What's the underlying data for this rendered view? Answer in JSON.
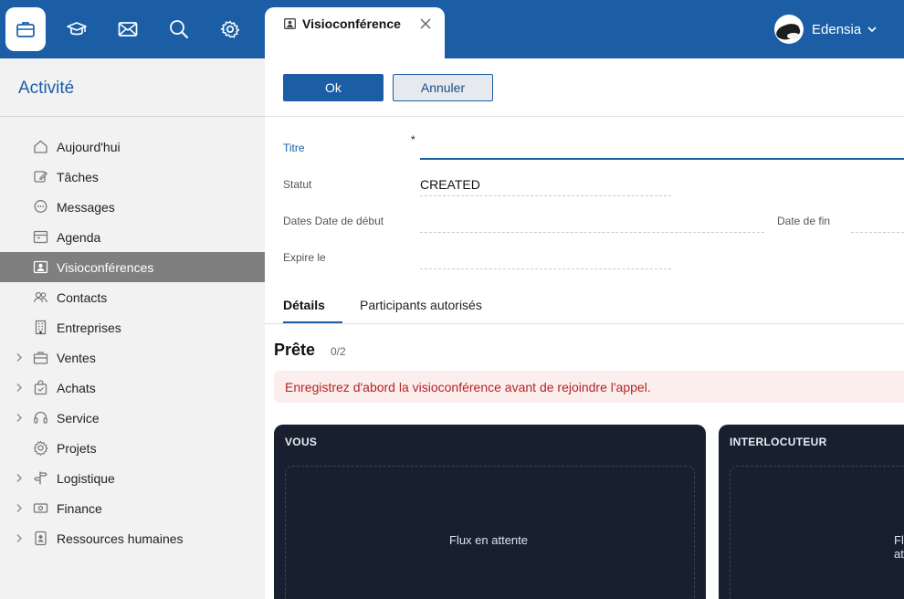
{
  "topbar": {
    "apps": [
      {
        "icon": "briefcase-icon",
        "active": true
      },
      {
        "icon": "graduation-cap-icon",
        "active": false
      },
      {
        "icon": "envelope-icon",
        "active": false
      },
      {
        "icon": "search-icon",
        "active": false
      },
      {
        "icon": "gear-icon",
        "active": false
      }
    ],
    "active_tab": {
      "label": "Visioconférence",
      "icon": "video-conference-icon"
    },
    "user": {
      "name": "Edensia"
    }
  },
  "sidebar": {
    "title": "Activité",
    "items": [
      {
        "label": "Aujourd'hui",
        "icon": "home-icon",
        "expandable": false
      },
      {
        "label": "Tâches",
        "icon": "edit-icon",
        "expandable": false
      },
      {
        "label": "Messages",
        "icon": "chat-icon",
        "expandable": false
      },
      {
        "label": "Agenda",
        "icon": "calendar-icon",
        "expandable": false
      },
      {
        "label": "Visioconférences",
        "icon": "video-conference-icon",
        "expandable": false,
        "selected": true
      },
      {
        "label": "Contacts",
        "icon": "contacts-icon",
        "expandable": false
      },
      {
        "label": "Entreprises",
        "icon": "building-icon",
        "expandable": false
      },
      {
        "label": "Ventes",
        "icon": "briefcase-icon",
        "expandable": true
      },
      {
        "label": "Achats",
        "icon": "shopping-bag-icon",
        "expandable": true
      },
      {
        "label": "Service",
        "icon": "headset-icon",
        "expandable": true
      },
      {
        "label": "Projets",
        "icon": "gear-icon",
        "expandable": false
      },
      {
        "label": "Logistique",
        "icon": "signpost-icon",
        "expandable": true
      },
      {
        "label": "Finance",
        "icon": "banknote-icon",
        "expandable": true
      },
      {
        "label": "Ressources humaines",
        "icon": "id-badge-icon",
        "expandable": true
      }
    ]
  },
  "toolbar": {
    "ok_label": "Ok",
    "cancel_label": "Annuler"
  },
  "form": {
    "title_label": "Titre",
    "title_required_mark": "*",
    "title_value": "",
    "status_label": "Statut",
    "status_value": "CREATED",
    "dates_label": "Dates Date de début",
    "start_value": "",
    "end_label": "Date de fin",
    "end_value": "",
    "expires_label": "Expire le",
    "expires_value": ""
  },
  "subtabs": [
    {
      "label": "Détails",
      "active": true
    },
    {
      "label": "Participants autorisés",
      "active": false
    }
  ],
  "call": {
    "status_title": "Prête",
    "participants_count": "0/2",
    "alert_text": "Enregistrez d'abord la visioconférence avant de rejoindre l'appel.",
    "panels": [
      {
        "title": "VOUS",
        "stream_text": "Flux en attente"
      },
      {
        "title": "INTERLOCUTEUR",
        "stream_text": "Flux en attente"
      }
    ]
  },
  "colors": {
    "brand": "#1b5ea6",
    "selected_bg": "#7f7f7f",
    "alert_text": "#b42323",
    "alert_bg": "#fdeeee",
    "panel_bg": "#18202f"
  }
}
